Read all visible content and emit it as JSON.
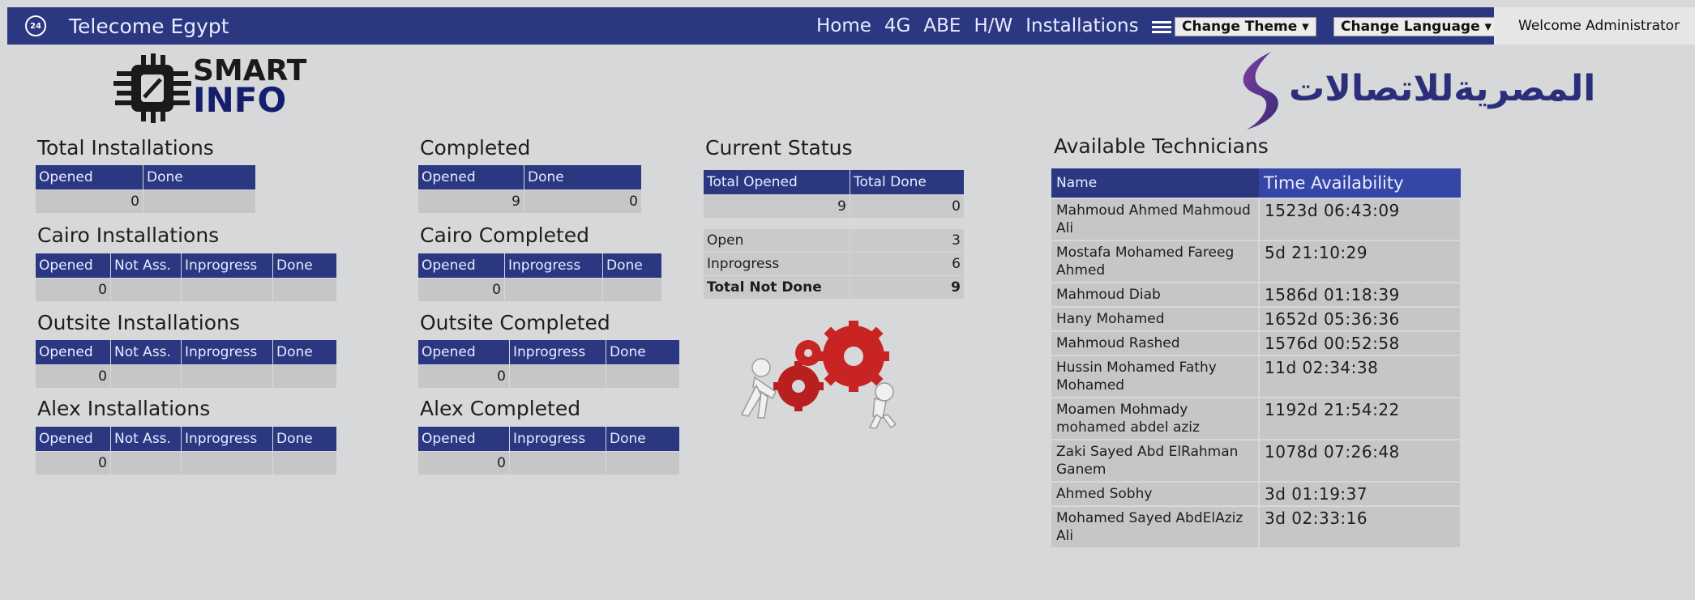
{
  "header": {
    "app_icon": "clock-24-icon",
    "title": "Telecome Egypt",
    "nav": [
      "Home",
      "4G",
      "ABE",
      "H/W",
      "Installations"
    ],
    "menu_icon": "hamburger-menu-icon",
    "change_theme": "Change Theme ▾",
    "change_language": "Change Language ▾",
    "welcome": "Welcome Administrator"
  },
  "logos": {
    "smart_line1": "SMART",
    "smart_line2": "INFO",
    "egypt_arabic": "المصريةللاتصالات"
  },
  "total": {
    "title": "Total Installations",
    "headers": [
      "Opened",
      "Done"
    ],
    "values": [
      "0",
      ""
    ]
  },
  "cairo": {
    "title": "Cairo Installations",
    "headers": [
      "Opened",
      "Not Ass.",
      "Inprogress",
      "Done"
    ],
    "values": [
      "0",
      "",
      "",
      ""
    ]
  },
  "outsite": {
    "title": "Outsite Installations",
    "headers": [
      "Opened",
      "Not Ass.",
      "Inprogress",
      "Done"
    ],
    "values": [
      "0",
      "",
      "",
      ""
    ]
  },
  "alex": {
    "title": "Alex Installations",
    "headers": [
      "Opened",
      "Not Ass.",
      "Inprogress",
      "Done"
    ],
    "values": [
      "0",
      "",
      "",
      ""
    ]
  },
  "completed": {
    "title": "Completed",
    "headers": [
      "Opened",
      "Done"
    ],
    "values": [
      "9",
      "0"
    ]
  },
  "cairo_completed": {
    "title": "Cairo Completed",
    "headers": [
      "Opened",
      "Inprogress",
      "Done"
    ],
    "values": [
      "0",
      "",
      ""
    ]
  },
  "outsite_completed": {
    "title": "Outsite Completed",
    "headers": [
      "Opened",
      "Inprogress",
      "Done"
    ],
    "values": [
      "0",
      "",
      ""
    ]
  },
  "alex_completed": {
    "title": "Alex Completed",
    "headers": [
      "Opened",
      "Inprogress",
      "Done"
    ],
    "values": [
      "0",
      "",
      ""
    ]
  },
  "status": {
    "title": "Current Status",
    "headers": [
      "Total Opened",
      "Total Done"
    ],
    "values": [
      "9",
      "0"
    ],
    "rows": [
      {
        "label": "Open",
        "value": "3"
      },
      {
        "label": "Inprogress",
        "value": "6"
      },
      {
        "label": "Total Not Done",
        "value": "9"
      }
    ]
  },
  "technicians": {
    "title": "Available Technicians",
    "col_name": "Name",
    "col_time": "Time Availability",
    "rows": [
      {
        "name": "Mahmoud Ahmed Mahmoud Ali",
        "time": "1523d 06:43:09"
      },
      {
        "name": "Mostafa Mohamed Fareeg Ahmed",
        "time": "5d 21:10:29"
      },
      {
        "name": "Mahmoud  Diab",
        "time": "1586d 01:18:39"
      },
      {
        "name": "Hany Mohamed",
        "time": "1652d 05:36:36"
      },
      {
        "name": "Mahmoud  Rashed",
        "time": "1576d 00:52:58"
      },
      {
        "name": "Hussin Mohamed Fathy Mohamed",
        "time": "11d 02:34:38"
      },
      {
        "name": "Moamen Mohmady mohamed abdel aziz",
        "time": "1192d 21:54:22"
      },
      {
        "name": "Zaki Sayed Abd ElRahman Ganem",
        "time": "1078d 07:26:48"
      },
      {
        "name": "Ahmed Sobhy",
        "time": "3d 01:19:37"
      },
      {
        "name": "Mohamed Sayed AbdElAziz Ali",
        "time": "3d 02:33:16"
      }
    ]
  },
  "colors": {
    "header_bg": "#2b3781",
    "page_bg": "#d7d8d9",
    "cell_bg": "#c5c6c8",
    "gear_red": "#d42a2a"
  }
}
